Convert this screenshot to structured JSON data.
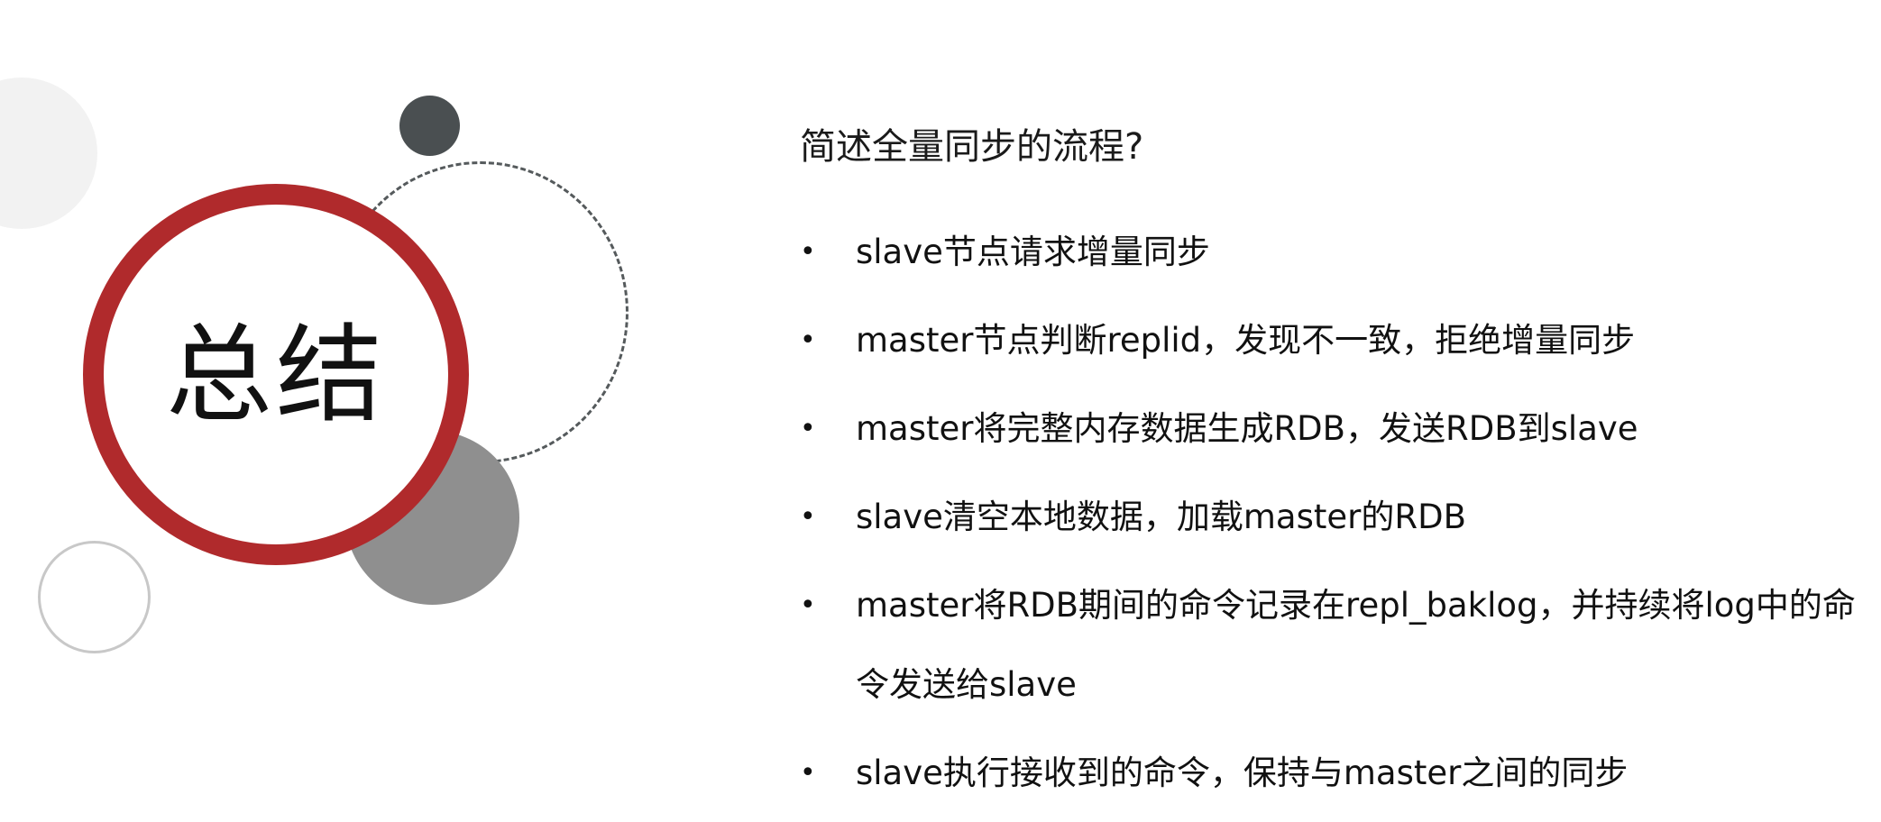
{
  "slide": {
    "title": "总结",
    "question": "简述全量同步的流程?",
    "bullet_glyph": "•",
    "bullets": [
      "slave节点请求增量同步",
      "master节点判断replid，发现不一致，拒绝增量同步",
      "master将完整内存数据生成RDB，发送RDB到slave",
      "slave清空本地数据，加载master的RDB",
      "master将RDB期间的命令记录在repl_baklog，并持续将log中的命令发送给slave",
      "slave执行接收到的命令，保持与master之间的同步"
    ]
  },
  "colors": {
    "accent_red": "#b02a2c",
    "dark_gray": "#4a4f51",
    "mid_gray": "#8f8f8f",
    "light_gray": "#f2f2f2",
    "outline_gray": "#c8c8c8"
  }
}
